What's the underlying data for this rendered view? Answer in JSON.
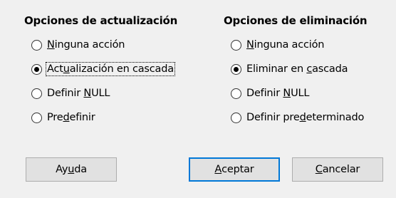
{
  "update_options": {
    "title": "Opciones de actualización",
    "options": [
      {
        "pre": "",
        "key": "N",
        "post": "inguna acción",
        "checked": false
      },
      {
        "pre": "Act",
        "key": "u",
        "post": "alización en cascada",
        "checked": true
      },
      {
        "pre": "Definir ",
        "key": "N",
        "post": "ULL",
        "checked": false
      },
      {
        "pre": "Pre",
        "key": "d",
        "post": "efinir",
        "checked": false
      }
    ]
  },
  "delete_options": {
    "title": "Opciones de eliminación",
    "options": [
      {
        "pre": "",
        "key": "N",
        "post": "inguna acción",
        "checked": false
      },
      {
        "pre": "Eliminar en ",
        "key": "c",
        "post": "ascada",
        "checked": true
      },
      {
        "pre": "Definir ",
        "key": "N",
        "post": "ULL",
        "checked": false
      },
      {
        "pre": "Definir pre",
        "key": "d",
        "post": "eterminado",
        "checked": false
      }
    ]
  },
  "buttons": {
    "help": {
      "pre": "Ay",
      "key": "u",
      "post": "da"
    },
    "ok": {
      "pre": "",
      "key": "A",
      "post": "ceptar"
    },
    "cancel": {
      "pre": "",
      "key": "C",
      "post": "ancelar"
    }
  }
}
